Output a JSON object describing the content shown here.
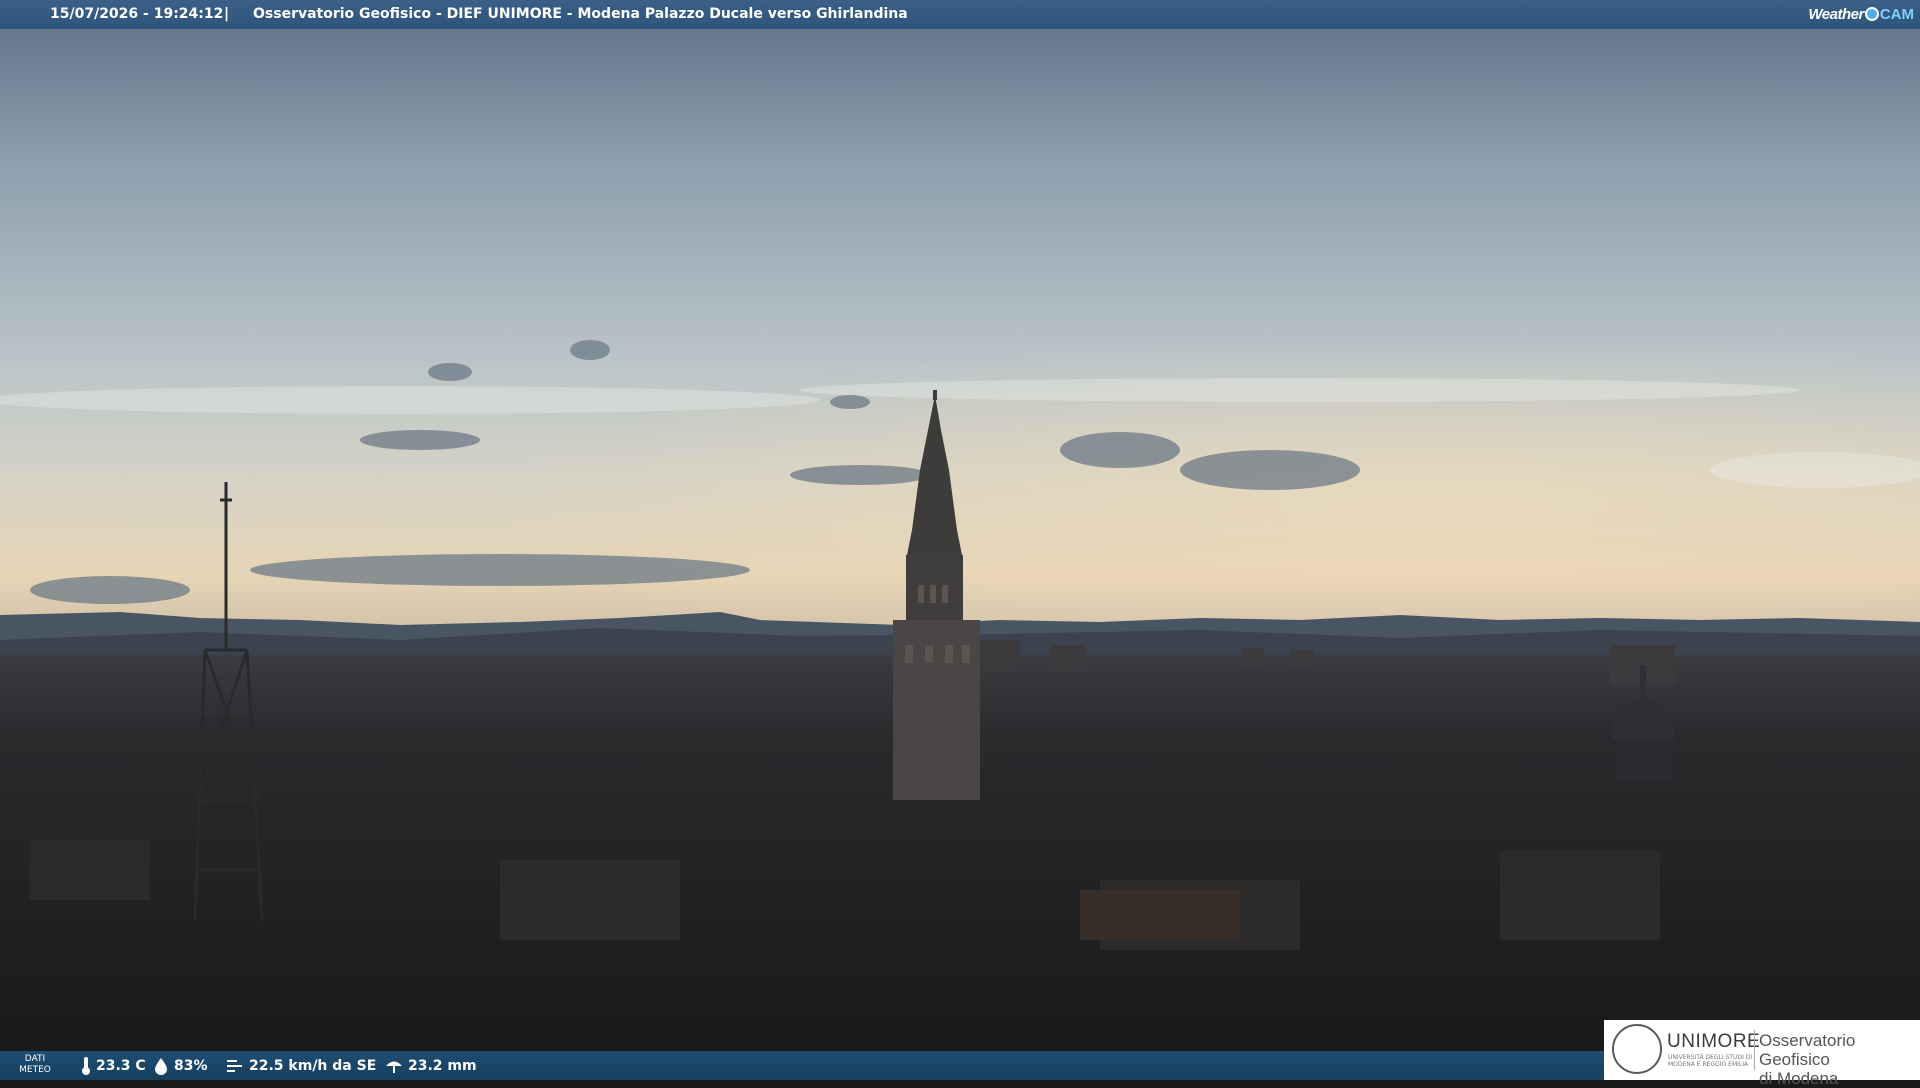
{
  "header": {
    "datetime": "15/07/2026 - 19:24:12",
    "separator": "|",
    "title": "Osservatorio Geofisico - DIEF UNIMORE - Modena Palazzo Ducale verso Ghirlandina",
    "brand_weather": "Weather",
    "brand_cam": "CAM"
  },
  "weather": {
    "label_line1": "DATI",
    "label_line2": "METEO",
    "temperature": "23.3 C",
    "humidity": "83%",
    "wind": "22.5 km/h da SE",
    "rain": "23.2 mm",
    "icons": [
      "thermometer-icon",
      "humidity-icon",
      "wind-icon",
      "rain-icon"
    ]
  },
  "logo": {
    "university": "UNIMORE",
    "university_sub": "UNIVERSITÀ DEGLI STUDI DI MODENA E REGGIO EMILIA",
    "observatory_line1": "Osservatorio Geofisico",
    "observatory_line2": "di Modena"
  },
  "colors": {
    "topbar": "#33597f",
    "bottombar": "#1b4668",
    "brand_accent": "#4fb0e8",
    "logo_accent": "#b5301e"
  }
}
